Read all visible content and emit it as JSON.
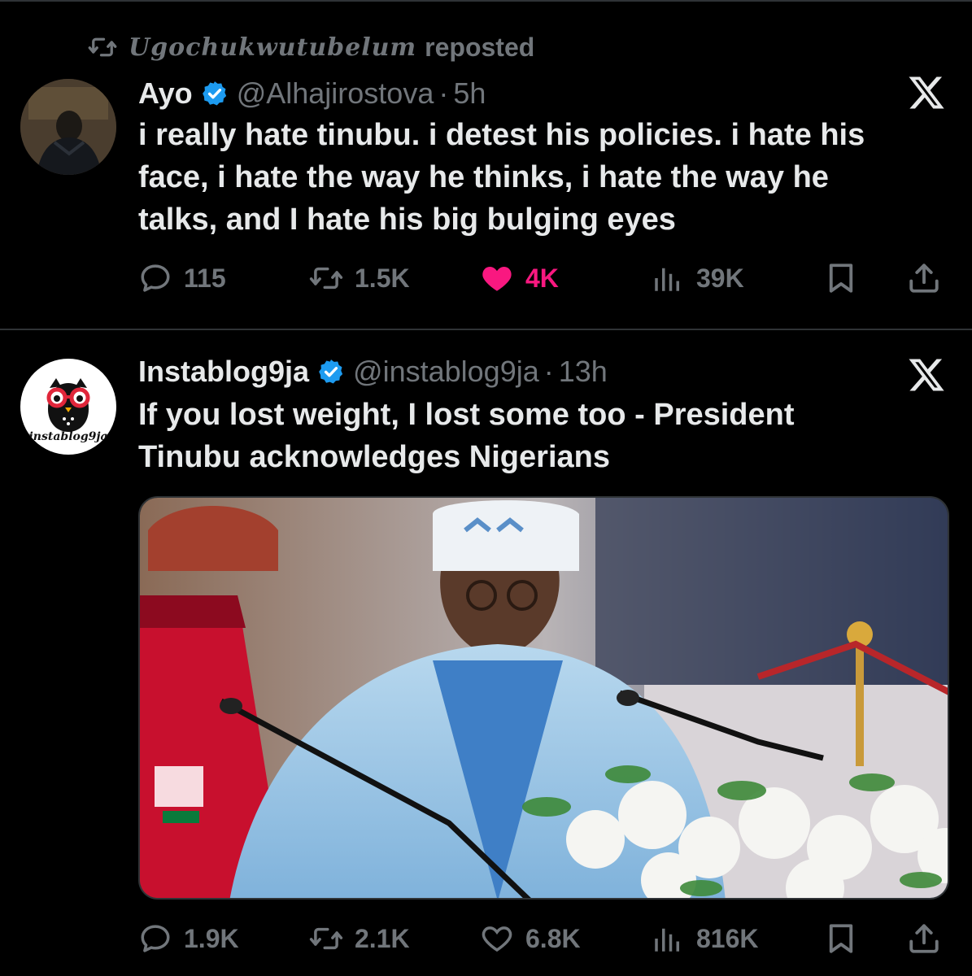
{
  "repost_line": {
    "user": "Ugochukwutubelum",
    "action": "reposted"
  },
  "tweets": [
    {
      "name": "Ayo",
      "handle": "@Alhajirostova",
      "sep": "·",
      "time": "5h",
      "lines": [
        "i really hate tinubu. i detest his policies. i hate his",
        "face, i hate the way he thinks, i hate the way he",
        "talks, and I hate his big bulging eyes"
      ],
      "replies": "115",
      "reposts": "1.5K",
      "likes": "4K",
      "views": "39K",
      "liked": true
    },
    {
      "name": "Instablog9ja",
      "handle": "@instablog9ja",
      "sep": "·",
      "time": "13h",
      "avatar_text": "instablog9ja",
      "lines": [
        "If you lost weight, I lost some too - President",
        "Tinubu acknowledges Nigerians"
      ],
      "replies": "1.9K",
      "reposts": "2.1K",
      "likes": "6.8K",
      "views": "816K",
      "liked": false
    }
  ],
  "colors": {
    "background": "#000000",
    "text": "#e7e9ea",
    "muted": "#71767b",
    "verified": "#1d9bf0",
    "like": "#f91880"
  },
  "icons": [
    "repost-icon",
    "verified-icon",
    "x-logo-icon",
    "reply-icon",
    "like-icon",
    "views-icon",
    "bookmark-icon",
    "share-icon"
  ]
}
